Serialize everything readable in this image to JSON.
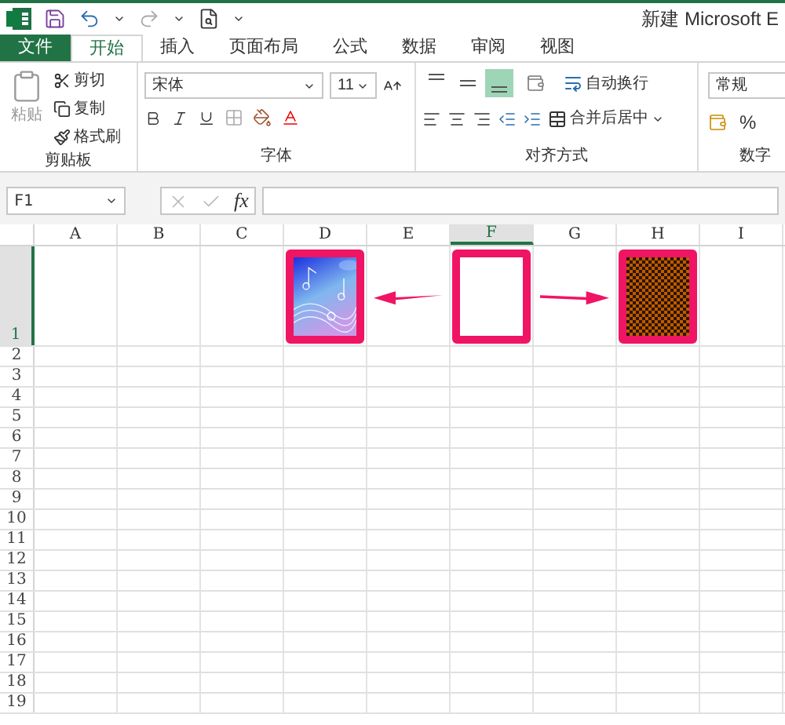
{
  "title_bar": {
    "title": "新建 Microsoft E"
  },
  "tabs": [
    {
      "label": "文件",
      "kind": "file",
      "selected": false
    },
    {
      "label": "开始",
      "kind": "tab",
      "selected": true
    },
    {
      "label": "插入",
      "kind": "tab",
      "selected": false
    },
    {
      "label": "页面布局",
      "kind": "tab",
      "selected": false
    },
    {
      "label": "公式",
      "kind": "tab",
      "selected": false
    },
    {
      "label": "数据",
      "kind": "tab",
      "selected": false
    },
    {
      "label": "审阅",
      "kind": "tab",
      "selected": false
    },
    {
      "label": "视图",
      "kind": "tab",
      "selected": false
    }
  ],
  "ribbon": {
    "clipboard": {
      "paste": "粘贴",
      "cut": "剪切",
      "copy": "复制",
      "format_painter": "格式刷",
      "label": "剪贴板"
    },
    "font": {
      "name": "宋体",
      "size": "11",
      "label": "字体"
    },
    "alignment": {
      "vertical": [
        {
          "selected": false
        },
        {
          "selected": false
        },
        {
          "selected": true
        }
      ],
      "wrap_text": "自动换行",
      "merge_center": "合并后居中",
      "label": "对齐方式"
    },
    "number": {
      "format": "常规",
      "percent": "%",
      "label": "数字"
    }
  },
  "formula_bar": {
    "name_box": "F1",
    "fx": "fx"
  },
  "sheet": {
    "columns": [
      {
        "label": "A",
        "selected": false
      },
      {
        "label": "B",
        "selected": false
      },
      {
        "label": "C",
        "selected": false
      },
      {
        "label": "D",
        "selected": false
      },
      {
        "label": "E",
        "selected": false
      },
      {
        "label": "F",
        "selected": true
      },
      {
        "label": "G",
        "selected": false
      },
      {
        "label": "H",
        "selected": false
      },
      {
        "label": "I",
        "selected": false
      }
    ],
    "rows": [
      {
        "label": "1",
        "selected": true
      },
      {
        "label": "2",
        "selected": false
      },
      {
        "label": "3",
        "selected": false
      },
      {
        "label": "4",
        "selected": false
      },
      {
        "label": "5",
        "selected": false
      },
      {
        "label": "6",
        "selected": false
      },
      {
        "label": "7",
        "selected": false
      },
      {
        "label": "8",
        "selected": false
      },
      {
        "label": "9",
        "selected": false
      },
      {
        "label": "10",
        "selected": false
      },
      {
        "label": "11",
        "selected": false
      },
      {
        "label": "12",
        "selected": false
      },
      {
        "label": "13",
        "selected": false
      },
      {
        "label": "14",
        "selected": false
      },
      {
        "label": "15",
        "selected": false
      },
      {
        "label": "16",
        "selected": false
      },
      {
        "label": "17",
        "selected": false
      },
      {
        "label": "18",
        "selected": false
      },
      {
        "label": "19",
        "selected": false
      }
    ]
  },
  "shapes": [
    {
      "kind": "picture"
    },
    {
      "kind": "empty"
    },
    {
      "kind": "pattern"
    }
  ]
}
